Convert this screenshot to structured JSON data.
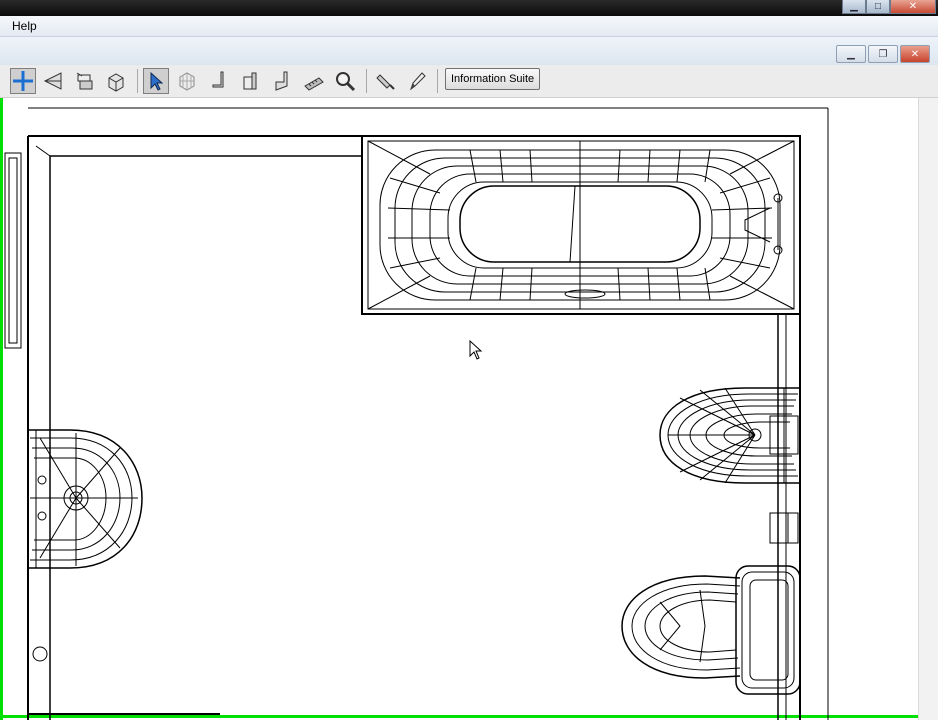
{
  "menubar": {
    "help_label": "Help"
  },
  "window_controls": {
    "minimize_icon": "minimize-icon",
    "restore_icon": "restore-icon",
    "close_icon": "close-icon"
  },
  "toolbar": {
    "information_suite_label": "Information Suite",
    "tools": [
      "move-icon",
      "perspective-icon",
      "cabinet-layer-icon",
      "box-3d-icon",
      "select-pointer-icon",
      "grid-cube-icon",
      "wall-segment-icon",
      "door-icon",
      "wall-corner-icon",
      "tape-measure-icon",
      "zoom-icon",
      "paint-icon",
      "pencil-icon"
    ]
  },
  "plan": {
    "fixtures": [
      "bathtub",
      "bidet",
      "toilet",
      "washbasin"
    ],
    "colors": {
      "viewport_border": "#00e000",
      "line": "#000000"
    }
  }
}
